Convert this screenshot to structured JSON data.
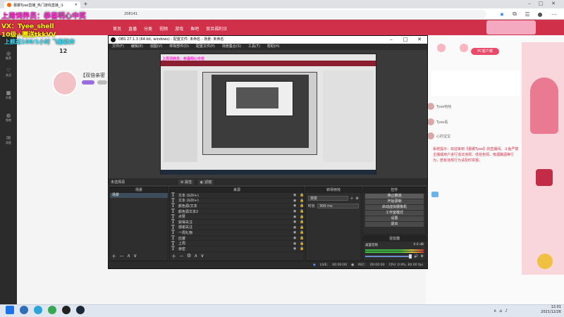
{
  "browser": {
    "tab_title": "蕾娜Tyee直播_热门游戏直播_斗",
    "url_text": "208141"
  },
  "overlay": {
    "line1": "上周词养员：恭喜明心中奖",
    "line2": "VX：Tyee_shell",
    "line3": "10级+赠送tkkVV",
    "line4": "上舰送100/1小时 飞船就奔"
  },
  "site": {
    "nav": [
      "首页",
      "直播",
      "分类",
      "视频",
      "游戏",
      "鱼吧",
      "双旦福利日"
    ],
    "streamer_title": "【双倍亲密",
    "follow_count": "12",
    "pc_button": "PC客户端",
    "broadcast": "系统提示：欢迎来到【蕾娜Tyee】的直播间。斗鱼严禁主播或用户进行违法违规、低俗色情、吸烟酗酒等行为，若有违规行为请及时举报。",
    "chat_names": [
      "Tyee哈哈",
      "Tyee看",
      "心的宝宝"
    ],
    "left_nav": [
      "推荐",
      "关注",
      "分类",
      "鱼吧",
      "消息"
    ]
  },
  "obs": {
    "title": "OBS 27.1.3 (64-bit, windows) - 配置文件: 未命名 - 场景: 未命名",
    "menu": [
      "文件(F)",
      "编辑(E)",
      "视图(V)",
      "停靠部件(D)",
      "配置文件(P)",
      "场景集合(S)",
      "工具(T)",
      "帮助(H)"
    ],
    "source_bar": {
      "label": "未选择源",
      "properties": "属性",
      "filters": "滤镜"
    },
    "docks": {
      "scenes": "场景",
      "sources": "来源",
      "mixer": "转场特效",
      "controls": "控件",
      "audio": "混音器"
    },
    "scenes": [
      "场景"
    ],
    "sources": [
      "文本 (GDI+)",
      "文本 (GDI+)",
      "颜色源/文本",
      "颜色源文本2",
      "点赞",
      "获得关注",
      "感谢关注",
      "一周礼物",
      "应援",
      "上周",
      "亲密"
    ],
    "transition": {
      "selected": "渐变",
      "duration_label": "时长",
      "duration_value": "300 ms"
    },
    "controls": [
      "停止推流",
      "开始录制",
      "启动虚拟摄像机",
      "工作室模式",
      "设置",
      "退出"
    ],
    "audio_source": "桌面音频",
    "audio_db": "0.0 dB",
    "status": {
      "live_label": "LIVE:",
      "live_time": "00:00:00",
      "rec_label": "REC:",
      "rec_time": "00:00:00",
      "cpu": "CPU: 0.9%, 60.00 fps"
    }
  },
  "taskbar": {
    "time": "12:01",
    "date": "2021/12/26"
  },
  "colors": {
    "site_red": "#d03049",
    "obs_bg": "#3a3a3a",
    "overlay_pink": "#ff2bd0",
    "overlay_yellow": "#fffb00",
    "overlay_cyan": "#35e4ff"
  }
}
